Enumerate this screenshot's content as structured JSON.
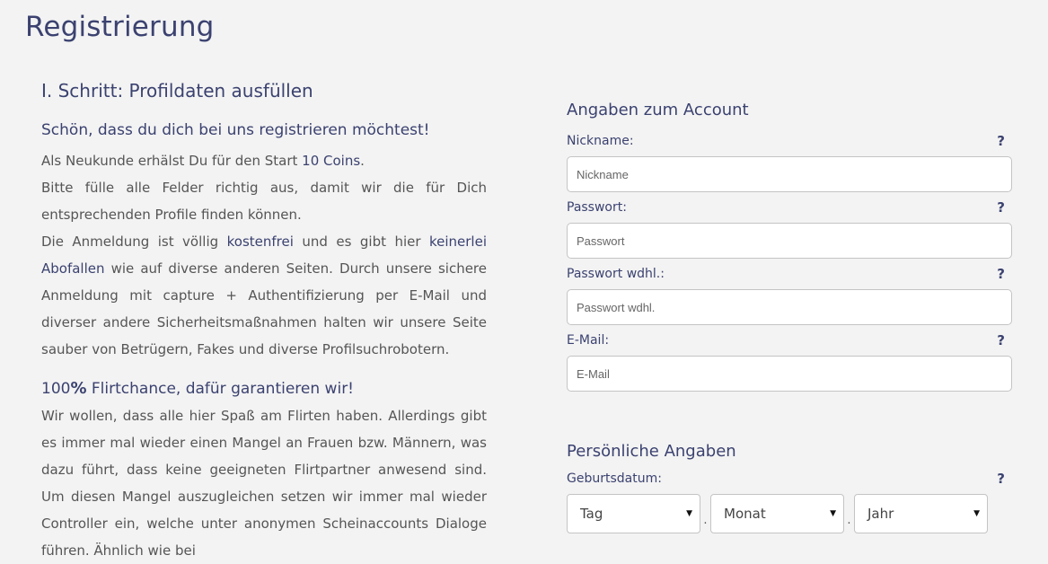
{
  "page": {
    "title": "Registrierung"
  },
  "left": {
    "step_title": "I. Schritt: Profildaten ausfüllen",
    "intro_heading": "Schön, dass du dich bei uns registrieren möchtest!",
    "p1_pre": "Als Neukunde erhälst Du für den Start ",
    "p1_coins": "10 Coins",
    "p1_post": ".",
    "p2": "Bitte fülle alle Felder richtig aus, damit wir die für Dich entsprechenden Profile finden können.",
    "p3_pre": "Die Anmeldung ist völlig ",
    "p3_free": "kostenfrei",
    "p3_mid": " und es gibt hier ",
    "p3_noabo": "keinerlei Abofallen",
    "p3_post": " wie auf diverse anderen Seiten. Durch unsere sichere Anmeldung mit capture + Authentifizierung per E-Mail und diverser andere Sicherheitsmaßnahmen halten wir unsere Seite sauber von Betrügern, Fakes und diverse Profilsuchrobotern.",
    "flirt_num": "100",
    "flirt_pct": "%",
    "flirt_rest": " Flirtchance, dafür garantieren wir!",
    "p4": "Wir wollen, dass alle hier Spaß am Flirten haben. Allerdings gibt es immer mal wieder einen Mangel an Frauen bzw. Männern, was dazu führt, dass keine geeigneten Flirtpartner anwesend sind. Um diesen Mangel auszugleichen setzen wir immer mal wieder Controller ein, welche unter anonymen Scheinaccounts Dialoge führen. Ähnlich wie bei"
  },
  "account": {
    "title": "Angaben zum Account",
    "help": "?",
    "nickname": {
      "label": "Nickname:",
      "placeholder": "Nickname"
    },
    "password": {
      "label": "Passwort:",
      "placeholder": "Passwort"
    },
    "password_repeat": {
      "label": "Passwort wdhl.:",
      "placeholder": "Passwort wdhl."
    },
    "email": {
      "label": "E-Mail:",
      "placeholder": "E-Mail"
    }
  },
  "personal": {
    "title": "Persönliche Angaben",
    "birthdate_label": "Geburtsdatum:",
    "help": "?",
    "day": "Tag",
    "month": "Monat",
    "year": "Jahr",
    "separator": "."
  }
}
